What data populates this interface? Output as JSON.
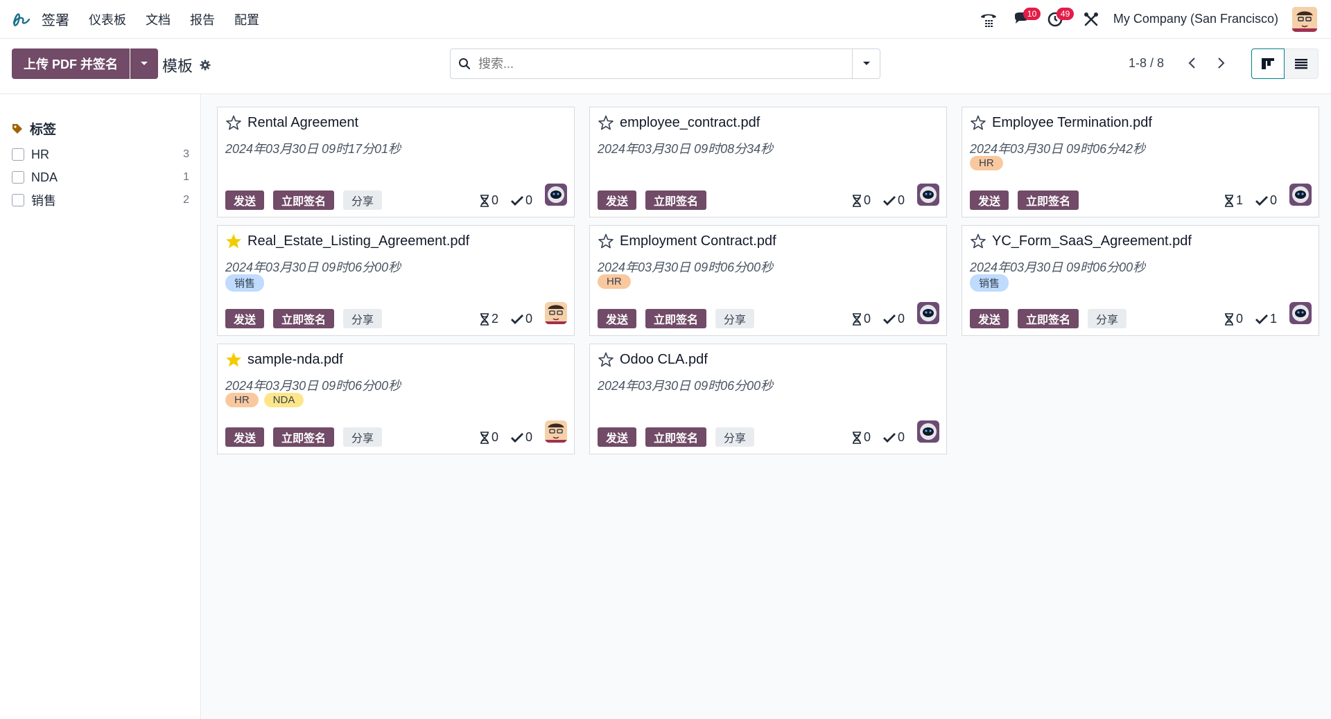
{
  "navbar": {
    "app_name": "签署",
    "menu": [
      "仪表板",
      "文档",
      "报告",
      "配置"
    ],
    "messages_count": "10",
    "activities_count": "49",
    "company": "My Company (San Francisco)"
  },
  "control": {
    "upload_label": "上传 PDF 并签名",
    "breadcrumb": "模板",
    "search_placeholder": "搜索...",
    "pager": "1-8 / 8"
  },
  "sidebar": {
    "heading": "标签",
    "items": [
      {
        "label": "HR",
        "count": "3"
      },
      {
        "label": "NDA",
        "count": "1"
      },
      {
        "label": "销售",
        "count": "2"
      }
    ]
  },
  "buttons": {
    "send": "发送",
    "sign_now": "立即签名",
    "share": "分享"
  },
  "colors": {
    "brand": "#714b67",
    "star": "#f3cc00",
    "tag_hr": "#f9c89e",
    "tag_nda": "#fde68a",
    "tag_sales": "#bfdbfe"
  },
  "cards": [
    {
      "title": "Rental Agreement",
      "date": "2024年03月30日 09时17分01秒",
      "starred": false,
      "tags": [],
      "share": true,
      "pending": "0",
      "signed": "0",
      "avatar": "robot"
    },
    {
      "title": "employee_contract.pdf",
      "date": "2024年03月30日 09时08分34秒",
      "starred": false,
      "tags": [],
      "share": false,
      "pending": "0",
      "signed": "0",
      "avatar": "robot"
    },
    {
      "title": "Employee Termination.pdf",
      "date": "2024年03月30日 09时06分42秒",
      "starred": false,
      "tags": [
        "HR"
      ],
      "share": false,
      "pending": "1",
      "signed": "0",
      "avatar": "robot"
    },
    {
      "title": "Real_Estate_Listing_Agreement.pdf",
      "date": "2024年03月30日 09时06分00秒",
      "starred": true,
      "tags": [
        "销售"
      ],
      "share": true,
      "pending": "2",
      "signed": "0",
      "avatar": "person"
    },
    {
      "title": "Employment Contract.pdf",
      "date": "2024年03月30日 09时06分00秒",
      "starred": false,
      "tags": [
        "HR"
      ],
      "share": true,
      "pending": "0",
      "signed": "0",
      "avatar": "robot"
    },
    {
      "title": "YC_Form_SaaS_Agreement.pdf",
      "date": "2024年03月30日 09时06分00秒",
      "starred": false,
      "tags": [
        "销售"
      ],
      "share": true,
      "pending": "0",
      "signed": "1",
      "avatar": "robot"
    },
    {
      "title": "sample-nda.pdf",
      "date": "2024年03月30日 09时06分00秒",
      "starred": true,
      "tags": [
        "HR",
        "NDA"
      ],
      "share": true,
      "pending": "0",
      "signed": "0",
      "avatar": "person"
    },
    {
      "title": "Odoo CLA.pdf",
      "date": "2024年03月30日 09时06分00秒",
      "starred": false,
      "tags": [],
      "share": true,
      "pending": "0",
      "signed": "0",
      "avatar": "robot"
    }
  ]
}
